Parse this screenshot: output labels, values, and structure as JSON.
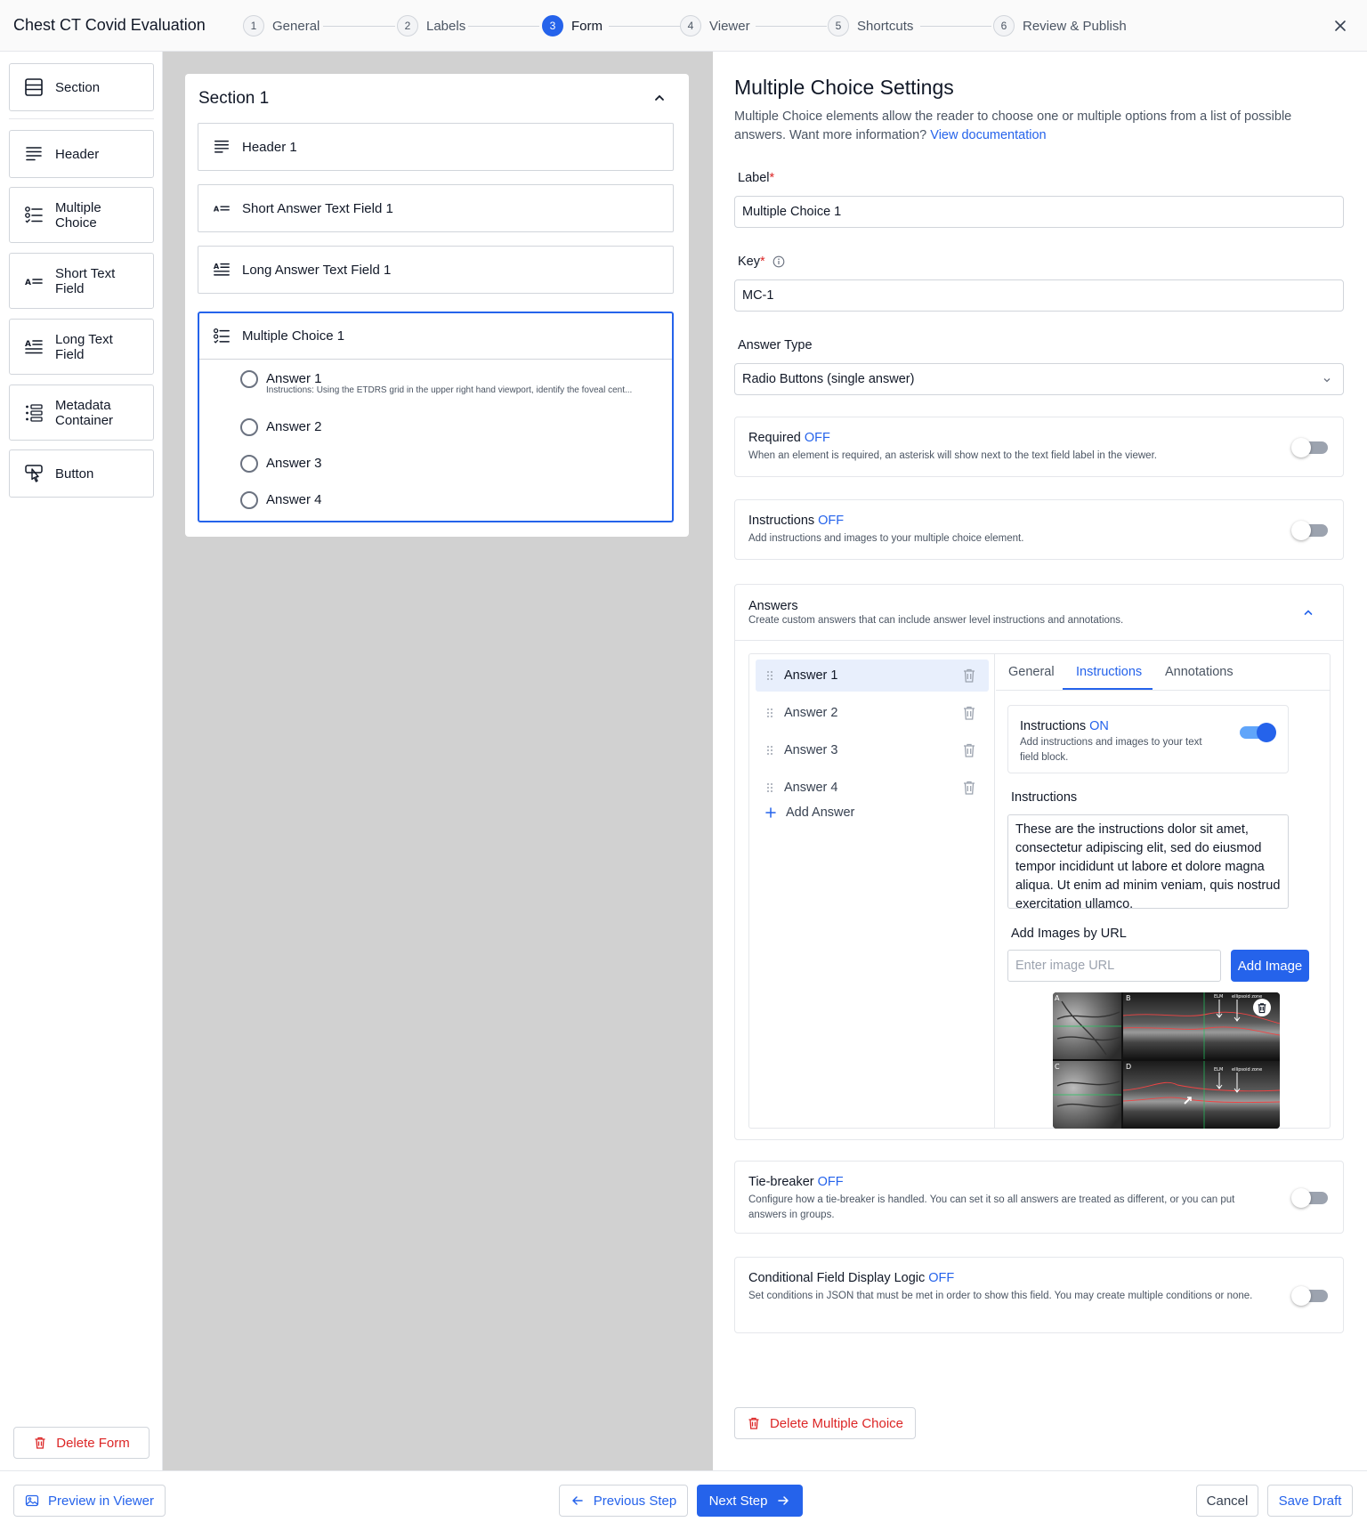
{
  "app": {
    "title": "Chest CT Covid Evaluation"
  },
  "steps": [
    {
      "num": "1",
      "label": "General"
    },
    {
      "num": "2",
      "label": "Labels"
    },
    {
      "num": "3",
      "label": "Form"
    },
    {
      "num": "4",
      "label": "Viewer"
    },
    {
      "num": "5",
      "label": "Shortcuts"
    },
    {
      "num": "6",
      "label": "Review & Publish"
    }
  ],
  "active_step": "3",
  "palette": {
    "items": [
      {
        "label": "Section",
        "icon": "section-icon"
      },
      {
        "label": "Header",
        "icon": "header-icon"
      },
      {
        "label": "Multiple Choice",
        "icon": "multiple-choice-icon"
      },
      {
        "label": "Short Text Field",
        "icon": "short-text-icon"
      },
      {
        "label": "Long Text Field",
        "icon": "long-text-icon"
      },
      {
        "label": "Metadata Container",
        "icon": "metadata-icon"
      },
      {
        "label": "Button",
        "icon": "button-icon"
      }
    ],
    "delete_form": "Delete Form"
  },
  "canvas": {
    "section_title": "Section 1",
    "elements": [
      {
        "label": "Header 1",
        "icon": "header-icon"
      },
      {
        "label": "Short Answer Text Field 1",
        "icon": "short-text-icon"
      },
      {
        "label": "Long Answer Text Field 1",
        "icon": "long-text-icon"
      }
    ],
    "multiple_choice": {
      "label": "Multiple Choice 1",
      "answers": [
        "Answer 1",
        "Answer 2",
        "Answer 3",
        "Answer 4"
      ],
      "answer1_instructions": "Instructions: Using the ETDRS grid in the upper right hand viewport, identify the foveal cent..."
    }
  },
  "settings": {
    "title": "Multiple Choice Settings",
    "description": "Multiple Choice elements allow the reader to choose one or multiple options from a list of possible answers. Want more information?",
    "doc_link": "View documentation",
    "label_label": "Label",
    "label_value": "Multiple Choice 1",
    "key_label": "Key",
    "key_value": "MC-1",
    "answer_type_label": "Answer Type",
    "answer_type_value": "Radio Buttons (single answer)",
    "required": {
      "title": "Required",
      "state": "OFF",
      "desc": "When an element is required, an asterisk will show next to the text field label in the viewer."
    },
    "instructions": {
      "title": "Instructions",
      "state": "OFF",
      "desc": "Add instructions and images to your multiple choice element."
    },
    "answers": {
      "title": "Answers",
      "desc": "Create custom answers that can include answer level instructions and annotations.",
      "list": [
        "Answer 1",
        "Answer 2",
        "Answer 3",
        "Answer 4"
      ],
      "add_label": "Add Answer",
      "tabs": [
        "General",
        "Instructions",
        "Annotations"
      ],
      "active_tab": "Instructions",
      "instr_toggle": {
        "title": "Instructions",
        "state": "ON",
        "desc": "Add instructions and images to your text field block."
      },
      "instructions_label": "Instructions",
      "instructions_text": "These are the instructions dolor sit amet, consectetur adipiscing elit, sed do eiusmod tempor incididunt ut labore et dolore magna aliqua. Ut enim ad minim veniam, quis nostrud exercitation ullamco.",
      "images_label": "Add Images by URL",
      "url_placeholder": "Enter image URL",
      "add_image": "Add Image",
      "image_labels": {
        "a": "A",
        "b": "B",
        "c": "C",
        "d": "D",
        "elm": "ELM",
        "ellipsoid": "ellipsoid zone"
      }
    },
    "tiebreaker": {
      "title": "Tie-breaker",
      "state": "OFF",
      "desc": "Configure how a tie-breaker is handled. You can set it so all answers are treated as different, or you can put answers in groups."
    },
    "conditional": {
      "title": "Conditional Field Display Logic",
      "state": "OFF",
      "desc": "Set conditions in JSON that must be met in order to show this field. You may create multiple conditions or none."
    },
    "delete_label": "Delete Multiple Choice"
  },
  "footer": {
    "preview": "Preview in Viewer",
    "previous": "Previous Step",
    "next": "Next Step",
    "cancel": "Cancel",
    "save": "Save Draft"
  },
  "colors": {
    "accent": "#2563eb",
    "danger": "#dc2626",
    "canvas_bg": "#d1d1d1"
  }
}
